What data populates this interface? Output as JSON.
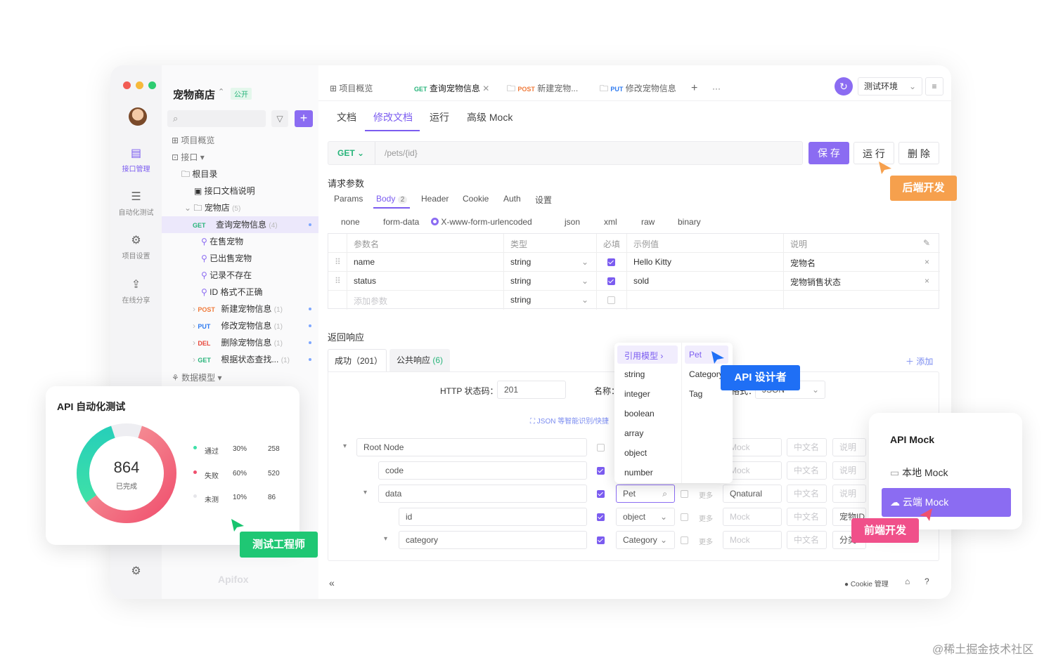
{
  "window": {
    "dots": [
      "#f25c54",
      "#f6b93b",
      "#2ecc71"
    ]
  },
  "rail": {
    "items": [
      {
        "label": "接口管理",
        "icon": "api-icon"
      },
      {
        "label": "自动化测试",
        "icon": "test-icon"
      },
      {
        "label": "项目设置",
        "icon": "settings-icon"
      },
      {
        "label": "在线分享",
        "icon": "share-icon"
      }
    ],
    "logo": "Apifox"
  },
  "project": {
    "name": "宠物商店",
    "badge": "公开",
    "chevron": "⌃"
  },
  "tree": {
    "overview": "项目概览",
    "api": "接口",
    "root": "根目录",
    "doc": "接口文档说明",
    "folder": "宠物店",
    "folder_count": "(5)",
    "selected": {
      "method": "GET",
      "name": "查询宠物信息",
      "count": "(4)"
    },
    "cases": [
      "在售宠物",
      "已出售宠物",
      "记录不存在",
      "ID 格式不正确"
    ],
    "others": [
      {
        "method": "POST",
        "name": "新建宠物信息",
        "count": "(1)"
      },
      {
        "method": "PUT",
        "name": "修改宠物信息",
        "count": "(1)"
      },
      {
        "method": "DEL",
        "name": "删除宠物信息",
        "count": "(1)"
      },
      {
        "method": "GET",
        "name": "根据状态查找...",
        "count": "(1)"
      }
    ],
    "models": "数据模型"
  },
  "tabs": [
    {
      "label": "项目概览"
    },
    {
      "method": "GET",
      "label": "查询宠物信息"
    },
    {
      "method": "POST",
      "label": "新建宠物..."
    },
    {
      "method": "PUT",
      "label": "修改宠物信息"
    }
  ],
  "tabs_extra": {
    "add": "+",
    "more": "···"
  },
  "env": {
    "label": "测试环境"
  },
  "subtabs": [
    "文档",
    "修改文档",
    "运行",
    "高级 Mock"
  ],
  "request": {
    "method": "GET",
    "path": "/pets/{id}",
    "save": "保 存",
    "run": "运 行",
    "delete": "删 除"
  },
  "params": {
    "title": "请求参数",
    "tabs": [
      "Params",
      "Body",
      "Header",
      "Cookie",
      "Auth",
      "设置"
    ],
    "body_count": "2",
    "body_types": [
      "none",
      "form-data",
      "X-www-form-urlencoded",
      "json",
      "xml",
      "raw",
      "binary"
    ],
    "headers": [
      "参数名",
      "类型",
      "必填",
      "示例值",
      "说明"
    ],
    "rows": [
      {
        "name": "name",
        "type": "string",
        "example": "Hello Kitty",
        "desc": "宠物名"
      },
      {
        "name": "status",
        "type": "string",
        "example": "sold",
        "desc": "宠物销售状态"
      }
    ],
    "add_placeholder": "添加参数",
    "add_type": "string"
  },
  "response": {
    "title": "返回响应",
    "tab_success": "成功（201）",
    "tab_common": "公共响应",
    "tab_common_count": "(6)",
    "add": "＋ 添加",
    "status_label": "HTTP 状态码：",
    "status_value": "201",
    "name_label": "名称：",
    "format_value": "JSON",
    "format_label": "格式：",
    "json_hint": "JSON 等智能识别/快捷",
    "nodes": [
      {
        "name": "Root Node"
      },
      {
        "name": "code"
      },
      {
        "name": "data",
        "type": "Pet",
        "more": "更多",
        "mock": "Qnatural"
      },
      {
        "name": "id",
        "type": "object",
        "more": "更多",
        "mock": "Mock",
        "desc": "宠物ID"
      },
      {
        "name": "category",
        "type": "Category",
        "more": "更多",
        "mock": "Mock",
        "desc": "分类"
      }
    ],
    "mock_ph": "Mock",
    "cn_ph": "中文名",
    "desc_ph": "说明"
  },
  "dropdown": {
    "header": "引用模型",
    "types": [
      "string",
      "integer",
      "boolean",
      "array",
      "object",
      "number"
    ],
    "models": [
      "Pet",
      "Category",
      "Tag"
    ]
  },
  "footer": {
    "cookie": "Cookie 管理",
    "collapse": "«"
  },
  "auto_card": {
    "title": "API 自动化测试",
    "total": "864",
    "total_label": "已完成",
    "legend": [
      {
        "label": "通过",
        "pct": "30%",
        "count": "258",
        "color": "#3ee0a8"
      },
      {
        "label": "失败",
        "pct": "60%",
        "count": "520",
        "color": "#f0506e"
      },
      {
        "label": "未测",
        "pct": "10%",
        "count": "86",
        "color": "#e6e6ea"
      }
    ]
  },
  "mock_card": {
    "title": "API Mock",
    "local": "本地 Mock",
    "cloud": "云端 Mock"
  },
  "tags": {
    "backend": "后端开发",
    "designer": "API 设计者",
    "tester": "测试工程师",
    "frontend": "前端开发"
  },
  "watermark": "@稀土掘金技术社区"
}
